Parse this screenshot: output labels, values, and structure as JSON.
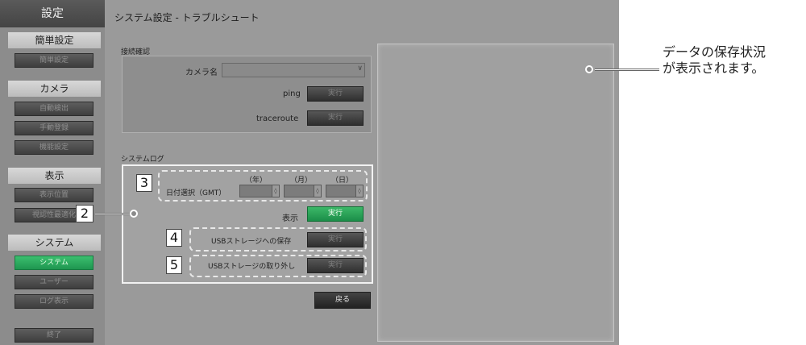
{
  "sidebar": {
    "title": "設定",
    "sections": [
      {
        "label": "簡単設定",
        "items": [
          "簡単設定"
        ]
      },
      {
        "label": "カメラ",
        "items": [
          "自動検出",
          "手動登録",
          "機能設定"
        ]
      },
      {
        "label": "表示",
        "items": [
          "表示位置",
          "視認性最適化"
        ]
      },
      {
        "label": "システム",
        "items": [
          "システム",
          "ユーザー",
          "ログ表示"
        ]
      }
    ],
    "exit_label": "終了"
  },
  "header": {
    "title": "システム設定 - トラブルシュート"
  },
  "connection": {
    "section_label": "接続確認",
    "camera_name_label": "カメラ名",
    "ping_label": "ping",
    "traceroute_label": "traceroute",
    "run_label": "実行"
  },
  "syslog": {
    "section_label": "システムログ",
    "year_label": "（年）",
    "month_label": "（月）",
    "day_label": "（日）",
    "date_select_label": "日付選択（GMT）",
    "display_label": "表示",
    "run_label": "実行",
    "usb_save_label": "USBストレージへの保存",
    "usb_remove_label": "USBストレージの取り外し"
  },
  "back_label": "戻る",
  "callouts": {
    "status_text_line1": "データの保存状況",
    "status_text_line2": "が表示されます。",
    "num2": "2",
    "num3": "3",
    "num4": "4",
    "num5": "5"
  },
  "colors": {
    "active_green": "#28a85a",
    "sidebar_bg": "#8c8c8c",
    "panel_bg": "#9a9a9a"
  }
}
